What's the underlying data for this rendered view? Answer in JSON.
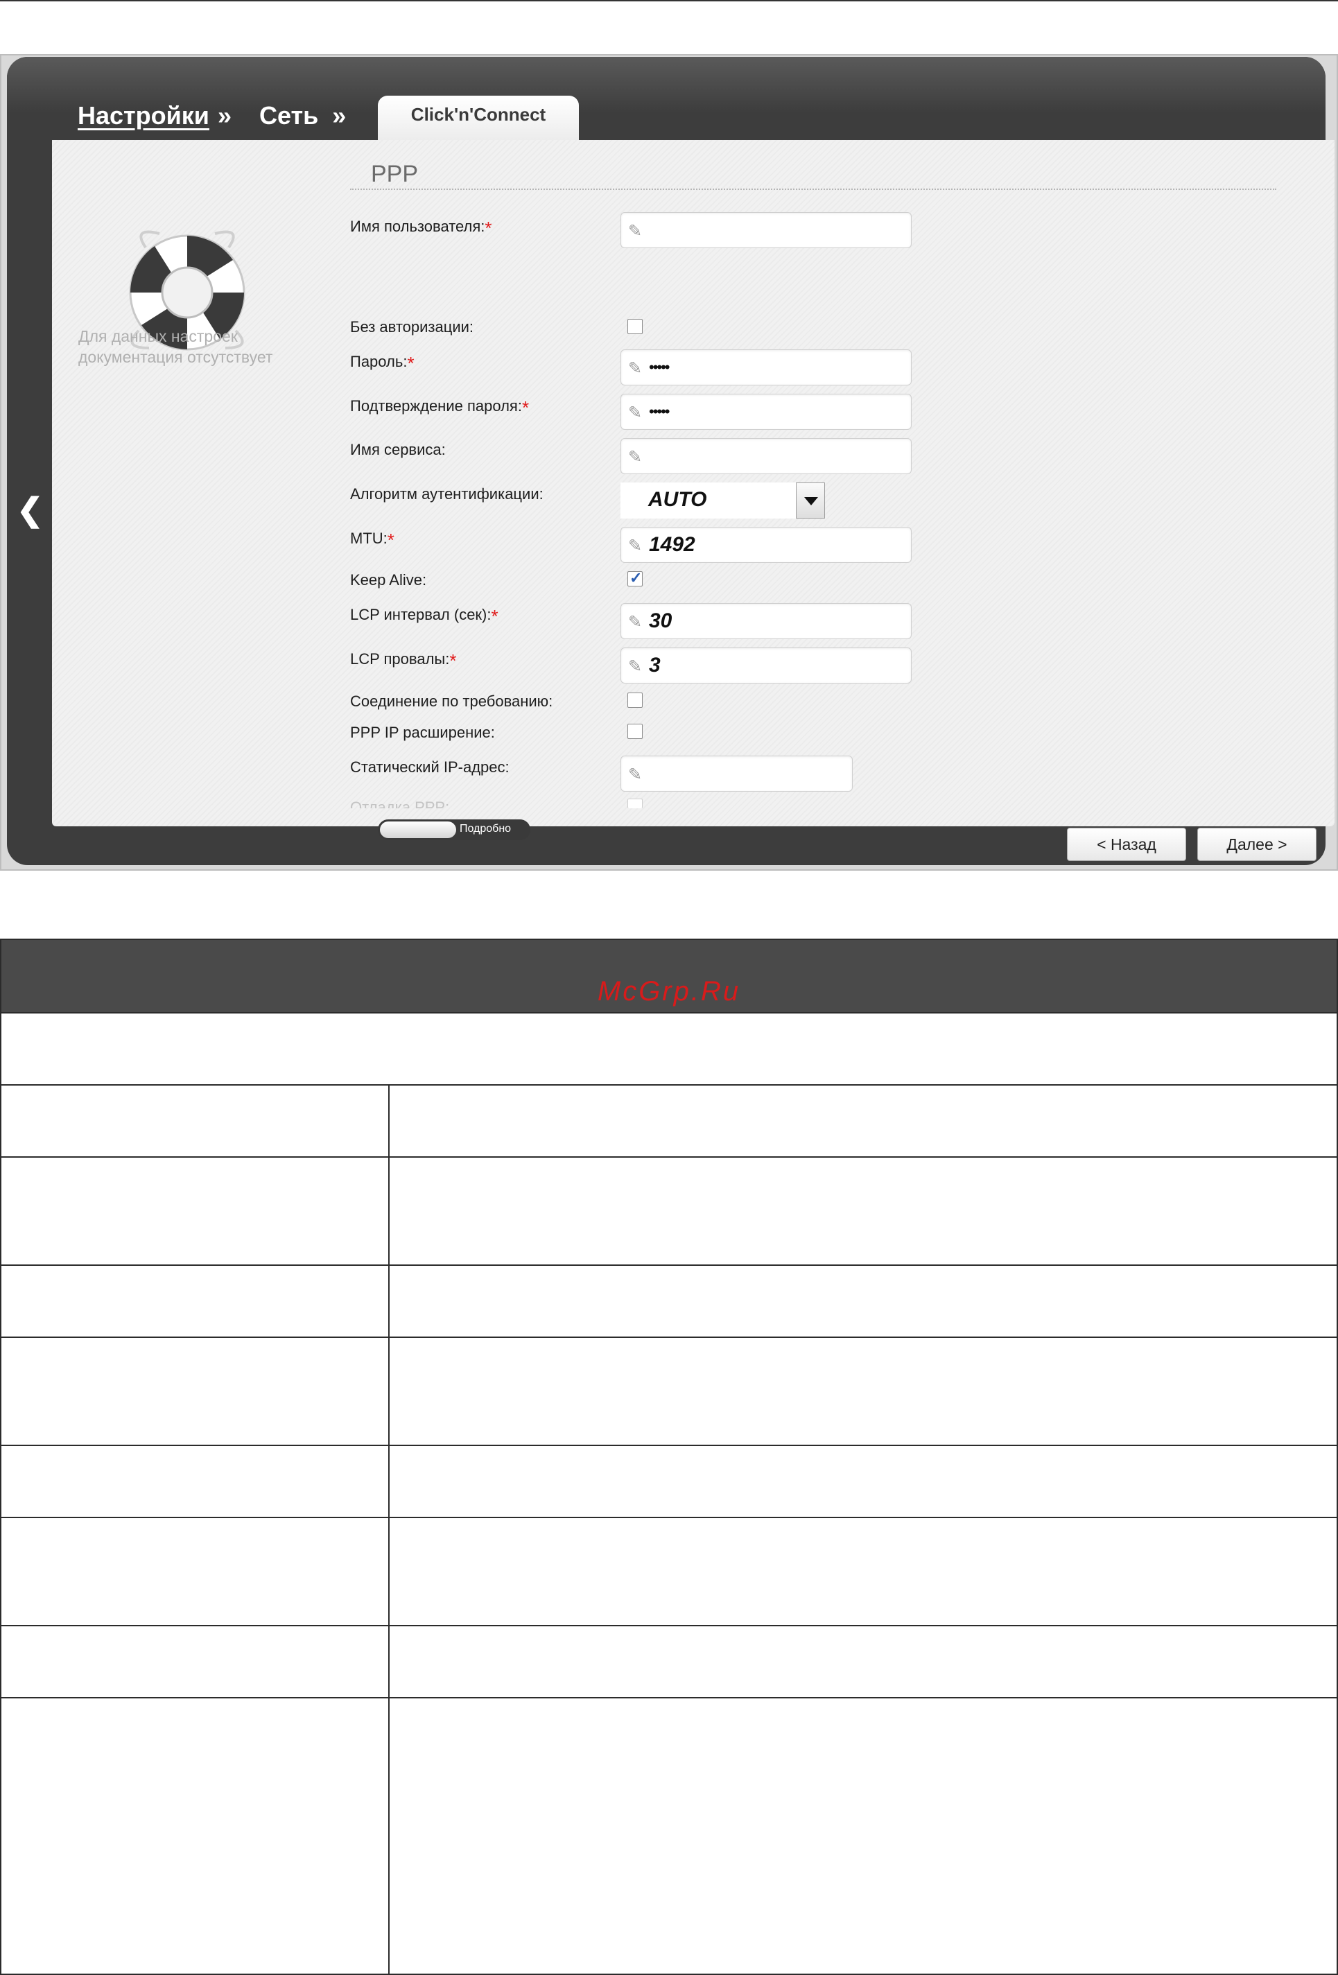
{
  "breadcrumb": {
    "item1": "Настройки",
    "sep1": "»",
    "item2": "Сеть",
    "sep2": "»"
  },
  "active_tab": "Click'n'Connect",
  "help_text": "Для данных настроек документация отсутствует",
  "section_title": "PPP",
  "form": {
    "username": {
      "label": "Имя пользователя:",
      "required": "*",
      "value": ""
    },
    "no_auth": {
      "label": "Без авторизации:",
      "checked": false
    },
    "password": {
      "label": "Пароль:",
      "required": "*",
      "value": "•••••"
    },
    "password_confirm": {
      "label": "Подтверждение пароля:",
      "required": "*",
      "value": "•••••"
    },
    "service_name": {
      "label": "Имя сервиса:",
      "value": ""
    },
    "auth_algorithm": {
      "label": "Алгоритм аутентификации:",
      "value": "AUTO"
    },
    "mtu": {
      "label": "MTU:",
      "required": "*",
      "value": "1492"
    },
    "keep_alive": {
      "label": "Keep Alive:",
      "checked": true
    },
    "lcp_interval": {
      "label": "LCP интервал (сек):",
      "required": "*",
      "value": "30"
    },
    "lcp_fails": {
      "label": "LCP провалы:",
      "required": "*",
      "value": "3"
    },
    "on_demand": {
      "label": "Соединение по требованию:",
      "checked": false
    },
    "ppp_ip_ext": {
      "label": "PPP IP расширение:",
      "checked": false
    },
    "static_ip": {
      "label": "Статический IP-адрес:",
      "value": ""
    },
    "ppp_debug": {
      "label": "Отладка PPP:",
      "checked": false
    }
  },
  "toggle_label": "Подробно",
  "buttons": {
    "back": "< Назад",
    "next": "Далее >"
  },
  "watermark": "McGrp.Ru",
  "colors": {
    "dark_frame": "#3d3d3d",
    "panel": "#f1f1f1",
    "required_star": "#e01b1b",
    "watermark": "#d81b1b"
  }
}
